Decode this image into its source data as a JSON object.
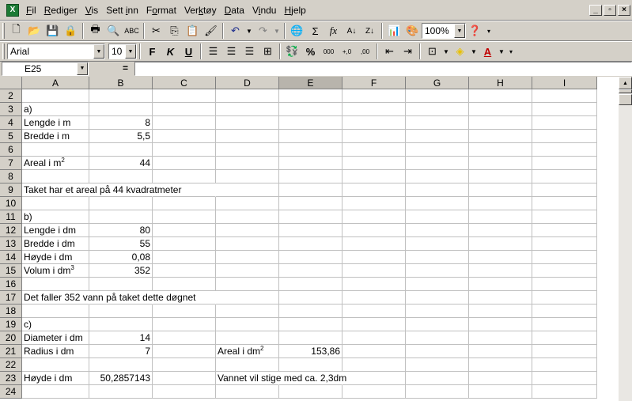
{
  "menu": {
    "items": [
      {
        "pre": "",
        "u": "F",
        "post": "il"
      },
      {
        "pre": "",
        "u": "R",
        "post": "ediger"
      },
      {
        "pre": "",
        "u": "V",
        "post": "is"
      },
      {
        "pre": "Sett ",
        "u": "i",
        "post": "nn"
      },
      {
        "pre": "F",
        "u": "o",
        "post": "rmat"
      },
      {
        "pre": "Ver",
        "u": "k",
        "post": "tøy"
      },
      {
        "pre": "",
        "u": "D",
        "post": "ata"
      },
      {
        "pre": "V",
        "u": "i",
        "post": "ndu"
      },
      {
        "pre": "",
        "u": "H",
        "post": "jelp"
      }
    ]
  },
  "toolbar": {
    "zoom": "100%",
    "font_name": "Arial",
    "font_size": "10",
    "bold": "F",
    "italic": "K",
    "underline": "U",
    "percent": "%",
    "thousands": "000",
    "inc_decimal": "+,0",
    "dec_decimal": ",00",
    "sigma": "Σ",
    "fx": "fx"
  },
  "formula_bar": {
    "name_box": "E25",
    "equals": "=",
    "value": ""
  },
  "columns": [
    "A",
    "B",
    "C",
    "D",
    "E",
    "F",
    "G",
    "H",
    "I"
  ],
  "active_column": "E",
  "rows": [
    {
      "n": "2",
      "a": "",
      "b": "",
      "d": "",
      "e": ""
    },
    {
      "n": "3",
      "a": "a)",
      "b": "",
      "d": "",
      "e": ""
    },
    {
      "n": "4",
      "a": "Lengde i m",
      "b": "8",
      "d": "",
      "e": ""
    },
    {
      "n": "5",
      "a": "Bredde i m",
      "b": "5,5",
      "d": "",
      "e": ""
    },
    {
      "n": "6",
      "a": "",
      "b": "",
      "d": "",
      "e": ""
    },
    {
      "n": "7",
      "a": "Areal i m",
      "a_sup": "2",
      "b": "44",
      "d": "",
      "e": ""
    },
    {
      "n": "8",
      "a": "",
      "b": "",
      "d": "",
      "e": ""
    },
    {
      "n": "9",
      "a": "Taket har et areal på 44 kvadratmeter",
      "overflow": true,
      "b": "",
      "d": "",
      "e": ""
    },
    {
      "n": "10",
      "a": "",
      "b": "",
      "d": "",
      "e": ""
    },
    {
      "n": "11",
      "a": "b)",
      "b": "",
      "d": "",
      "e": ""
    },
    {
      "n": "12",
      "a": "Lengde i dm",
      "b": "80",
      "d": "",
      "e": ""
    },
    {
      "n": "13",
      "a": "Bredde i dm",
      "b": "55",
      "d": "",
      "e": ""
    },
    {
      "n": "14",
      "a": "Høyde i dm",
      "b": "0,08",
      "d": "",
      "e": ""
    },
    {
      "n": "15",
      "a": "Volum i dm",
      "a_sup": "3",
      "b": "352",
      "d": "",
      "e": ""
    },
    {
      "n": "16",
      "a": "",
      "b": "",
      "d": "",
      "e": ""
    },
    {
      "n": "17",
      "a": "Det faller 352 vann på taket dette døgnet",
      "overflow": true,
      "b": "",
      "d": "",
      "e": ""
    },
    {
      "n": "18",
      "a": "",
      "b": "",
      "d": "",
      "e": ""
    },
    {
      "n": "19",
      "a": "c)",
      "b": "",
      "d": "",
      "e": ""
    },
    {
      "n": "20",
      "a": "Diameter i dm",
      "b": "14",
      "d": "",
      "e": ""
    },
    {
      "n": "21",
      "a": "Radius i dm",
      "b": "7",
      "d": "Areal i dm",
      "d_sup": "2",
      "e": "153,86"
    },
    {
      "n": "22",
      "a": "",
      "b": "",
      "d": "",
      "e": ""
    },
    {
      "n": "23",
      "a": "Høyde i dm",
      "b": "50,2857143",
      "d": "Vannet vil stige med ca. 2,3dm",
      "d_overflow": true,
      "e": ""
    },
    {
      "n": "24",
      "a": "",
      "b": "",
      "d": "",
      "e": ""
    }
  ]
}
